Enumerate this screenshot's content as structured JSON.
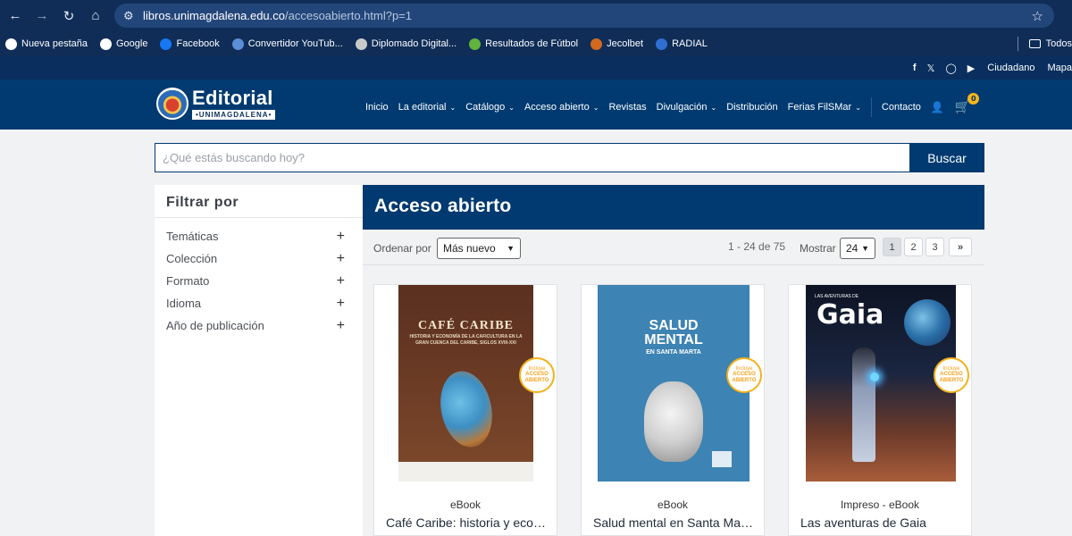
{
  "browser": {
    "url_host": "libros.unimagdalena.edu.co",
    "url_path": "/accesoabierto.html?p=1",
    "bookmarks": [
      {
        "label": "Nueva pestaña",
        "color": "#ffffff"
      },
      {
        "label": "Google",
        "color": "#ffffff"
      },
      {
        "label": "Facebook",
        "color": "#1877f2"
      },
      {
        "label": "Convertidor YouTub...",
        "color": "#5b8ed6"
      },
      {
        "label": "Diplomado Digital...",
        "color": "#c9c9c9"
      },
      {
        "label": "Resultados de Fútbol",
        "color": "#61b33b"
      },
      {
        "label": "Jecolbet",
        "color": "#d2691e"
      },
      {
        "label": "RADIAL",
        "color": "#2f6fd1"
      }
    ],
    "bookmarks_right": "Todos"
  },
  "topstrip": {
    "links": [
      "Ciudadano",
      "Mapa"
    ]
  },
  "header": {
    "logo_word": "Editorial",
    "logo_sub": "•UNIMAGDALENA•",
    "menu": [
      {
        "label": "Inicio",
        "dropdown": false
      },
      {
        "label": "La editorial",
        "dropdown": true
      },
      {
        "label": "Catálogo",
        "dropdown": true
      },
      {
        "label": "Acceso abierto",
        "dropdown": true
      },
      {
        "label": "Revistas",
        "dropdown": false
      },
      {
        "label": "Divulgación",
        "dropdown": true
      },
      {
        "label": "Distribución",
        "dropdown": false
      },
      {
        "label": "Ferias FilSMar",
        "dropdown": true
      },
      {
        "label": "Contacto",
        "dropdown": false
      }
    ],
    "cart_count": "0"
  },
  "search": {
    "placeholder": "¿Qué estás buscando hoy?",
    "button": "Buscar"
  },
  "filters": {
    "title": "Filtrar por",
    "items": [
      "Temáticas",
      "Colección",
      "Formato",
      "Idioma",
      "Año de publicación"
    ]
  },
  "content": {
    "title": "Acceso abierto",
    "sort_label": "Ordenar por",
    "sort_value": "Más nuevo",
    "count": "1 - 24 de 75",
    "show_label": "Mostrar",
    "show_value": "24",
    "pages": [
      "1",
      "2",
      "3",
      "»"
    ],
    "products": [
      {
        "format": "eBook",
        "title": "Café Caribe: historia y eco…",
        "cover_title": "CAFÉ CARIBE",
        "cover_subtitle": "HISTORIA Y ECONOMÍA DE LA CAFICULTURA EN LA GRAN CUENCA DEL CARIBE, SIGLOS XVIII-XXI",
        "badge_top": "Incluye",
        "badge_bottom": "ACCESO ABIERTO"
      },
      {
        "format": "eBook",
        "title": "Salud mental en Santa Mar…",
        "cover_title": "SALUD MENTAL",
        "cover_subtitle": "EN SANTA MARTA",
        "badge_top": "Incluye",
        "badge_bottom": "ACCESO ABIERTO"
      },
      {
        "format": "Impreso - eBook",
        "title": "Las aventuras de Gaia",
        "cover_title": "Gaia",
        "cover_subtitle": "LAS AVENTURAS DE",
        "badge_top": "Incluye",
        "badge_bottom": "ACCESO ABIERTO"
      }
    ]
  }
}
